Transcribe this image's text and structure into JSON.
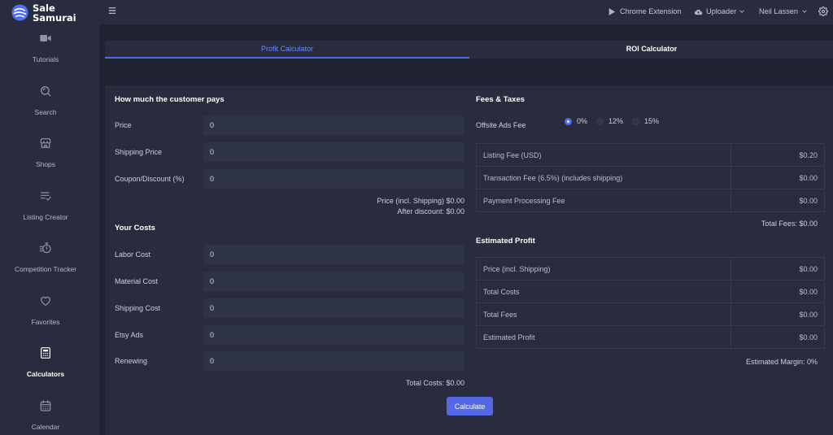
{
  "brand": {
    "line1": "Sale",
    "line2": "Samurai",
    "logo_icon": "samurai-wave-logo-icon"
  },
  "colors": {
    "accent": "#5468e6",
    "brand": "#4f6ef7",
    "tab_active": "#6f8bff"
  },
  "sidebar": {
    "items": [
      {
        "label": "Tutorials",
        "icon": "video-icon",
        "active": false
      },
      {
        "label": "Search",
        "icon": "search-icon",
        "active": false
      },
      {
        "label": "Shops",
        "icon": "shop-icon",
        "active": false
      },
      {
        "label": "Listing Creator",
        "icon": "listing-check-icon",
        "active": false
      },
      {
        "label": "Competition Tracker",
        "icon": "stopwatch-icon",
        "active": false
      },
      {
        "label": "Favorites",
        "icon": "heart-icon",
        "active": false
      },
      {
        "label": "Calculators",
        "icon": "calculator-icon",
        "active": true
      },
      {
        "label": "Calendar",
        "icon": "calendar-icon",
        "active": false
      }
    ]
  },
  "topbar": {
    "menu_icon": "menu-icon",
    "chrome_extension": {
      "label": "Chrome Extension",
      "icon": "play-icon"
    },
    "uploader": {
      "label": "Uploader",
      "icon": "cloud-upload-icon"
    },
    "user": {
      "name": "Neil Lassen"
    },
    "settings_icon": "gear-icon"
  },
  "tabs": [
    {
      "label": "Profit Calculator",
      "active": true
    },
    {
      "label": "ROI Calculator",
      "active": false
    }
  ],
  "customer_pays": {
    "title": "How much the customer pays",
    "fields": [
      {
        "label": "Price",
        "value": "0"
      },
      {
        "label": "Shipping Price",
        "value": "0"
      },
      {
        "label": "Coupon/Discount (%)",
        "value": "0"
      }
    ],
    "price_incl_shipping": {
      "label": "Price (incl. Shipping)",
      "value": "$0.00"
    },
    "after_discount": {
      "label": "After discount:",
      "value": "$0.00"
    }
  },
  "your_costs": {
    "title": "Your Costs",
    "fields": [
      {
        "label": "Labor Cost",
        "value": "0"
      },
      {
        "label": "Material Cost",
        "value": "0"
      },
      {
        "label": "Shipping Cost",
        "value": "0"
      },
      {
        "label": "Etsy Ads",
        "value": "0"
      },
      {
        "label": "Renewing",
        "value": "0"
      }
    ],
    "total": {
      "label": "Total Costs:",
      "value": "$0.00"
    }
  },
  "actions": {
    "calculate_label": "Calculate"
  },
  "fees": {
    "title": "Fees & Taxes",
    "offsite_ads": {
      "label": "Offsite Ads Fee",
      "options": [
        {
          "label": "0%",
          "checked": true
        },
        {
          "label": "12%",
          "checked": false
        },
        {
          "label": "15%",
          "checked": false
        }
      ]
    },
    "rows": [
      {
        "label": "Listing Fee (USD)",
        "value": "$0.20"
      },
      {
        "label": "Transaction Fee (6.5%) (includes shipping)",
        "value": "$0.00"
      },
      {
        "label": "Payment Processing Fee",
        "value": "$0.00"
      }
    ],
    "total": {
      "label": "Total Fees:",
      "value": "$0.00"
    }
  },
  "profit": {
    "title": "Estimated Profit",
    "rows": [
      {
        "label": "Price (incl. Shipping)",
        "value": "$0.00"
      },
      {
        "label": "Total Costs",
        "value": "$0.00"
      },
      {
        "label": "Total Fees",
        "value": "$0.00"
      },
      {
        "label": "Estimated Profit",
        "value": "$0.00"
      }
    ],
    "margin": {
      "label": "Estimated Margin:",
      "value": "0%"
    }
  }
}
